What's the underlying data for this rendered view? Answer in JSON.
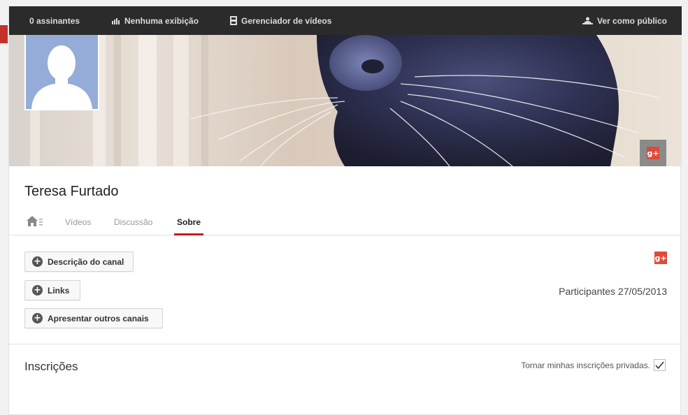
{
  "topbar": {
    "subscribers": "0 assinantes",
    "views": "Nenhuma exibição",
    "video_manager": "Gerenciador de vídeos",
    "view_as_public": "Ver como público"
  },
  "channel": {
    "name": "Teresa Furtado"
  },
  "tabs": [
    {
      "label": "Vídeos"
    },
    {
      "label": "Discussão"
    },
    {
      "label": "Sobre"
    }
  ],
  "about": {
    "buttons": {
      "description": "Descrição do canal",
      "links": "Links",
      "featured_channels": "Apresentar outros canais"
    },
    "joined": "Participantes 27/05/2013"
  },
  "subscriptions": {
    "title": "Inscrições",
    "private_label": "Tornar minhas inscrições privadas.",
    "private_checked": true
  },
  "colors": {
    "topbar_bg": "#2b2b2b",
    "accent_red": "#cc181e",
    "gplus_red": "#dd4b39",
    "avatar_bg": "#95acd9"
  },
  "icons": {
    "views": "bar-chart-icon",
    "video_manager": "film-icon",
    "view_as_public": "people-icon",
    "home": "home-icon",
    "gplus": "google-plus-icon",
    "add": "plus-circle-icon",
    "check": "checkmark-icon"
  }
}
